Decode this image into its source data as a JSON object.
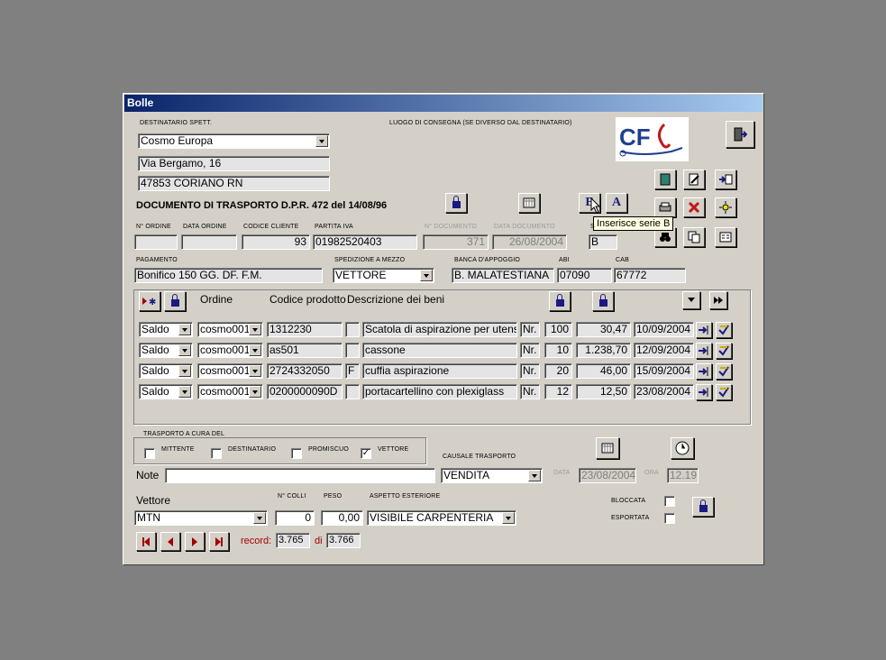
{
  "window": {
    "title": "Bolle"
  },
  "labels": {
    "destinatario": "DESTINATARIO SPETT.",
    "luogo": "LUOGO DI CONSEGNA (SE DIVERSO DAL DESTINATARIO)",
    "doc_title": "DOCUMENTO DI TRASPORTO D.P.R. 472 del 14/08/96",
    "n_ordine": "N° ORDINE",
    "data_ordine": "DATA ORDINE",
    "codice_cliente": "CODICE CLIENTE",
    "partita_iva": "PARTITA IVA",
    "n_documento": "N° DOCUMENTO",
    "data_documento": "DATA DOCUMENTO",
    "serie": "S",
    "pagamento": "PAGAMENTO",
    "spedizione": "SPEDIZIONE A MEZZO",
    "banca": "BANCA D'APPOGGIO",
    "abi": "ABI",
    "cab": "CAB",
    "trasporto_frame": "TRASPORTO A CURA DEL",
    "mittente": "MITTENTE",
    "destinatario_chk": "DESTINATARIO",
    "promiscuo": "PROMISCUO",
    "vettore_chk": "VETTORE",
    "causale": "CAUSALE TRASPORTO",
    "note": "Note",
    "data": "DATA",
    "ora": "ORA",
    "vettore": "Vettore",
    "n_colli": "N° COLLI",
    "peso": "PESO",
    "aspetto": "ASPETTO ESTERIORE",
    "bloccata": "BLOCCATA",
    "esportata": "ESPORTATA",
    "record": "record:",
    "di": "di"
  },
  "fields": {
    "destinatario": "Cosmo Europa",
    "indirizzo": "Via Bergamo, 16",
    "citta": "47853 CORIANO RN",
    "n_ordine": "",
    "data_ordine": "",
    "codice_cliente": "93",
    "partita_iva": "01982520403",
    "n_documento": "371",
    "data_documento": "26/08/2004",
    "serie": "B",
    "pagamento": "Bonifico 150 GG. DF. F.M.",
    "spedizione": "VETTORE",
    "banca": "B. MALATESTIANA",
    "abi": "07090",
    "cab": "67772",
    "note": "",
    "causale": "VENDITA",
    "data": "23/08/2004",
    "ora": "12.19",
    "vettore": "MTN",
    "n_colli": "0",
    "peso": "0,00",
    "aspetto": "VISIBILE CARPENTERIA",
    "record_current": "3.765",
    "record_total": "3.766"
  },
  "buttons": {
    "e_label": "E",
    "a_label": "A"
  },
  "tooltip": "Inserisce serie B",
  "grid": {
    "headers": {
      "ordine": "Ordine",
      "codice": "Codice prodotto",
      "descrizione": "Descrizione dei beni"
    },
    "rows": [
      {
        "tipo": "Saldo",
        "ordine": "cosmo001",
        "codice": "1312230",
        "flag": "",
        "descrizione": "Scatola di aspirazione per utensile c",
        "um": "Nr.",
        "qta": "100",
        "prezzo": "30,47",
        "data": "10/09/2004"
      },
      {
        "tipo": "Saldo",
        "ordine": "cosmo001",
        "codice": "as501",
        "flag": "",
        "descrizione": "cassone",
        "um": "Nr.",
        "qta": "10",
        "prezzo": "1.238,70",
        "data": "12/09/2004"
      },
      {
        "tipo": "Saldo",
        "ordine": "cosmo001",
        "codice": "2724332050",
        "flag": "F",
        "descrizione": "cuffia aspirazione",
        "um": "Nr.",
        "qta": "20",
        "prezzo": "46,00",
        "data": "15/09/2004"
      },
      {
        "tipo": "Saldo",
        "ordine": "cosmo001",
        "codice": "0200000090D",
        "flag": "",
        "descrizione": "portacartellino con plexiglass",
        "um": "Nr.",
        "qta": "12",
        "prezzo": "12,50",
        "data": "23/08/2004"
      }
    ]
  },
  "checks": {
    "mittente": false,
    "destinatario": false,
    "promiscuo": false,
    "vettore": true,
    "bloccata": false,
    "esportata": false
  },
  "colors": {
    "titlebar_start": "#0a246a",
    "titlebar_end": "#a6caf0",
    "record_label": "#a00000",
    "logo_blue": "#1f3f8f",
    "logo_red": "#c01818"
  }
}
